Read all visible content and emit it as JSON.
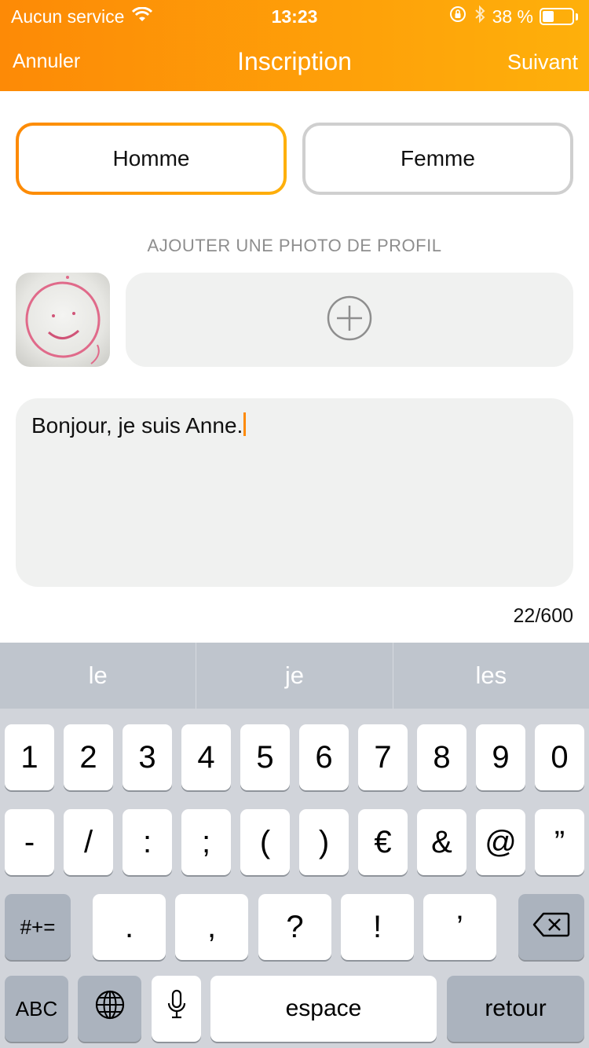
{
  "status_bar": {
    "carrier": "Aucun service",
    "time": "13:23",
    "battery_percent": "38 %",
    "battery_level": 0.38
  },
  "nav": {
    "cancel_label": "Annuler",
    "title": "Inscription",
    "next_label": "Suivant"
  },
  "gender": {
    "male_label": "Homme",
    "female_label": "Femme",
    "selected": "Homme"
  },
  "photo": {
    "label": "AJOUTER UNE PHOTO DE PROFIL"
  },
  "bio": {
    "value": "Bonjour, je suis Anne.",
    "counter": "22/600"
  },
  "keyboard": {
    "suggestions": [
      "le",
      "je",
      "les"
    ],
    "row1": [
      "1",
      "2",
      "3",
      "4",
      "5",
      "6",
      "7",
      "8",
      "9",
      "0"
    ],
    "row2": [
      "-",
      "/",
      ":",
      ";",
      "(",
      ")",
      "€",
      "&",
      "@",
      "”"
    ],
    "row3_mode": "#+=",
    "row3": [
      ".",
      ",",
      "?",
      "!",
      "’"
    ],
    "abc_label": "ABC",
    "space_label": "espace",
    "return_label": "retour"
  },
  "colors": {
    "accent_start": "#fd8a06",
    "accent_end": "#feb00b"
  }
}
